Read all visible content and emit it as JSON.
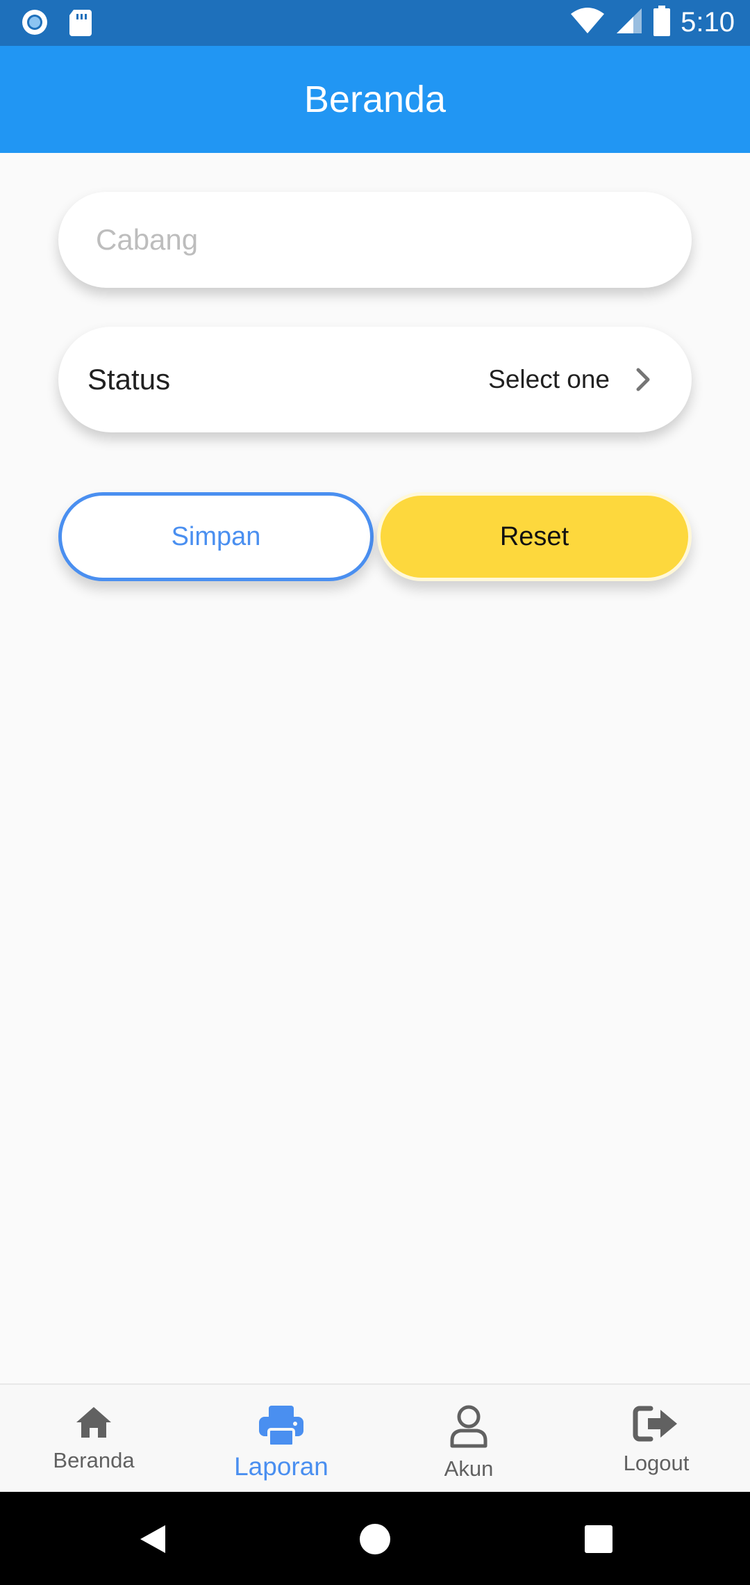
{
  "status_bar": {
    "time": "5:10",
    "icons": [
      "notification-dot-icon",
      "sd-card-icon",
      "wifi-icon",
      "signal-icon",
      "battery-icon"
    ]
  },
  "app_bar": {
    "title": "Beranda"
  },
  "form": {
    "cabang": {
      "placeholder": "Cabang",
      "value": ""
    },
    "status": {
      "label": "Status",
      "value": "Select one"
    }
  },
  "buttons": {
    "simpan_label": "Simpan",
    "reset_label": "Reset"
  },
  "bottom_nav": {
    "items": [
      {
        "label": "Beranda",
        "icon": "home-icon",
        "active": false
      },
      {
        "label": "Laporan",
        "icon": "print-icon",
        "active": true
      },
      {
        "label": "Akun",
        "icon": "user-icon",
        "active": false
      },
      {
        "label": "Logout",
        "icon": "logout-icon",
        "active": false
      }
    ]
  },
  "colors": {
    "status_bar": "#1e70bb",
    "app_bar": "#2196f3",
    "accent_blue": "#4a8ff0",
    "reset_yellow": "#fdd83d",
    "nav_inactive": "#616161"
  }
}
